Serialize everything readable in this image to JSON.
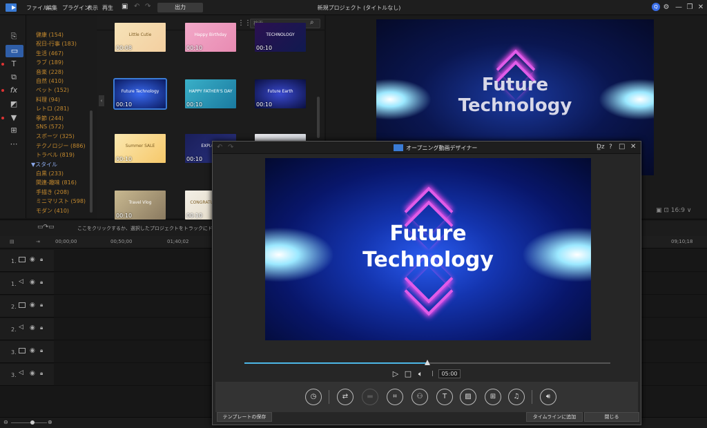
{
  "menubar": {
    "items": [
      "ファイル",
      "編集",
      "プラグイン",
      "表示",
      "再生"
    ],
    "export_label": "出力",
    "project_title": "新規プロジェクト (タイトルなし)",
    "avatar": "Q"
  },
  "categories": [
    "健康 (154)",
    "祝日-行事 (183)",
    "生活 (467)",
    "ラブ (189)",
    "音楽 (228)",
    "自然 (410)",
    "ペット (152)",
    "料理 (94)",
    "レトロ (281)",
    "季節 (244)",
    "SNS (572)",
    "スポーツ (325)",
    "テクノロジー (886)",
    "トラベル (819)"
  ],
  "style_header": "▼スタイル",
  "styles": [
    "白黒 (233)",
    "関連-趣味 (816)",
    "手描き (208)",
    "ミニマリスト (598)",
    "モダン (410)"
  ],
  "search": {
    "placeholder": "検索..."
  },
  "thumbs": [
    {
      "dur": "00:08",
      "cap": "Little Cutie"
    },
    {
      "dur": "00:10",
      "cap": "Happy Birthday"
    },
    {
      "dur": "00:10",
      "cap": "TECHNOLOGY"
    },
    {
      "dur": "00:10",
      "cap": "Future Technology"
    },
    {
      "dur": "00:10",
      "cap": "HAPPY FATHER'S DAY"
    },
    {
      "dur": "00:10",
      "cap": "Future Earth"
    },
    {
      "dur": "00:10",
      "cap": "Summer SALE"
    },
    {
      "dur": "00:10",
      "cap": "EXPLORE"
    },
    {
      "dur": "",
      "cap": ""
    },
    {
      "dur": "00:10",
      "cap": "Travel Vlog"
    },
    {
      "dur": "00:10",
      "cap": "CONGRATULATIONS"
    }
  ],
  "video": {
    "line1": "Future",
    "line2": "Technology"
  },
  "timeline": {
    "hint": "ここをクリックするか、選択したプロジェクトをトラックにドラッグします。",
    "ticks": [
      "00;00;00",
      "00;50;00",
      "01;40;02",
      "09;10;18"
    ],
    "tracks": [
      "1.",
      "1.",
      "2.",
      "2.",
      "3.",
      "3."
    ]
  },
  "dialog": {
    "title": "オープニング動画デザイナー",
    "timecode": "05:00",
    "progress": 0.5,
    "save_template": "テンプレートの保存",
    "add_to_timeline": "タイムラインに追加",
    "close": "閉じる"
  },
  "colors": {
    "accent": "#3a7bd5",
    "progress": "#4db8e8",
    "category": "#c58a2e"
  }
}
